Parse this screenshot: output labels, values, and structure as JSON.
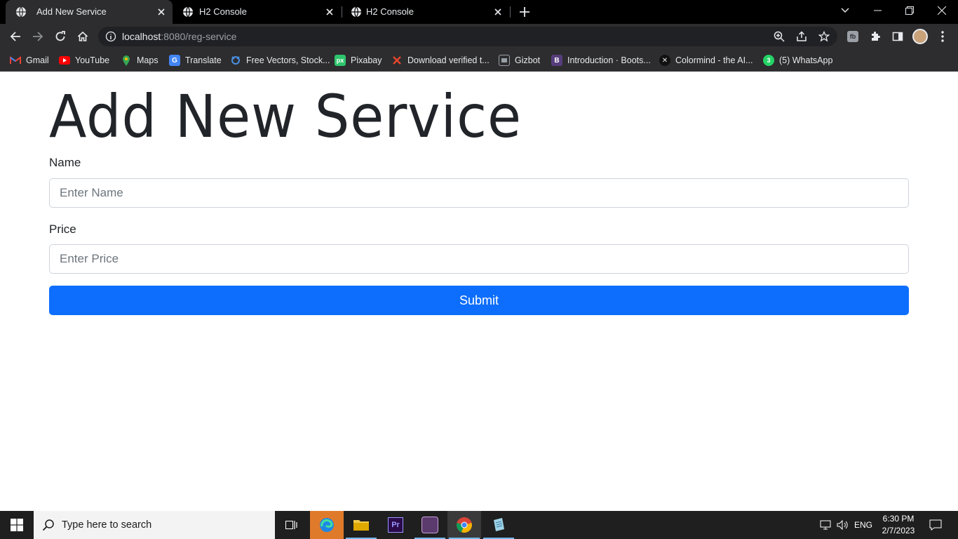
{
  "browser": {
    "tabs": [
      {
        "title": "Add New Service",
        "active": true
      },
      {
        "title": "H2 Console",
        "active": false
      },
      {
        "title": "H2 Console",
        "active": false
      }
    ],
    "url_host": "localhost",
    "url_rest": ":8080/reg-service",
    "bookmarks": [
      {
        "label": "Gmail",
        "icon": "gmail-icon"
      },
      {
        "label": "YouTube",
        "icon": "youtube-icon"
      },
      {
        "label": "Maps",
        "icon": "maps-icon"
      },
      {
        "label": "Translate",
        "icon": "translate-icon"
      },
      {
        "label": "Free Vectors, Stock...",
        "icon": "freepik-icon"
      },
      {
        "label": "Pixabay",
        "icon": "pixabay-icon"
      },
      {
        "label": "Download verified t...",
        "icon": "x-icon"
      },
      {
        "label": "Gizbot",
        "icon": "gizbot-icon"
      },
      {
        "label": "Introduction · Boots...",
        "icon": "bootstrap-icon"
      },
      {
        "label": "Colormind - the AI...",
        "icon": "colormind-icon"
      },
      {
        "label": "(5) WhatsApp",
        "icon": "whatsapp-icon"
      }
    ]
  },
  "form": {
    "heading": "Add New Service",
    "name_label": "Name",
    "name_placeholder": "Enter Name",
    "name_value": "",
    "price_label": "Price",
    "price_placeholder": "Enter Price",
    "price_value": "",
    "submit_label": "Submit",
    "accent": "#0d6efd"
  },
  "taskbar": {
    "search_placeholder": "Type here to search",
    "language": "ENG",
    "time": "6:30 PM",
    "date": "2/7/2023"
  }
}
